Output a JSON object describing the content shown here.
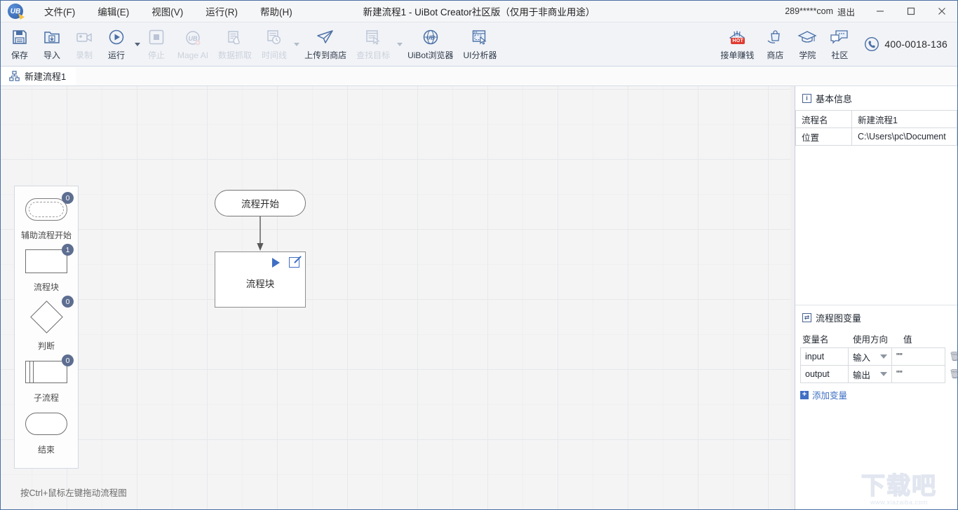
{
  "titlebar": {
    "logo_text": "UB",
    "menus": [
      {
        "label": "文件(F)",
        "name": "menu-file"
      },
      {
        "label": "编辑(E)",
        "name": "menu-edit"
      },
      {
        "label": "视图(V)",
        "name": "menu-view"
      },
      {
        "label": "运行(R)",
        "name": "menu-run"
      },
      {
        "label": "帮助(H)",
        "name": "menu-help"
      }
    ],
    "window_title": "新建流程1 - UiBot Creator社区版（仅用于非商业用途）",
    "account": "289*****com",
    "logout": "退出",
    "minimize": "—",
    "maximize": "☐",
    "close": "✕"
  },
  "toolbar": {
    "items": [
      {
        "label": "保存",
        "icon": "save-icon",
        "disabled": false,
        "caret": false
      },
      {
        "label": "导入",
        "icon": "import-icon",
        "disabled": false,
        "caret": false
      },
      {
        "label": "录制",
        "icon": "record-icon",
        "disabled": true,
        "caret": false
      },
      {
        "label": "运行",
        "icon": "run-icon",
        "disabled": false,
        "caret": true
      },
      {
        "label": "停止",
        "icon": "stop-icon",
        "disabled": true,
        "caret": false
      },
      {
        "label": "Mage AI",
        "icon": "mage-ai-icon",
        "disabled": true,
        "caret": false
      },
      {
        "label": "数据抓取",
        "icon": "data-scrape-icon",
        "disabled": true,
        "caret": false
      },
      {
        "label": "时间线",
        "icon": "timeline-icon",
        "disabled": true,
        "caret": true
      },
      {
        "label": "上传到商店",
        "icon": "upload-store-icon",
        "disabled": false,
        "caret": false
      },
      {
        "label": "查找目标",
        "icon": "find-target-icon",
        "disabled": true,
        "caret": true
      },
      {
        "label": "UiBot浏览器",
        "icon": "uibot-browser-icon",
        "disabled": false,
        "caret": false
      },
      {
        "label": "UI分析器",
        "icon": "ui-analyzer-icon",
        "disabled": false,
        "caret": false
      }
    ],
    "right_items": [
      {
        "label": "接单赚钱",
        "icon": "earn-money-icon",
        "badge": "HOT"
      },
      {
        "label": "商店",
        "icon": "store-icon",
        "badge": ""
      },
      {
        "label": "学院",
        "icon": "academy-icon",
        "badge": ""
      },
      {
        "label": "社区",
        "icon": "community-icon",
        "badge": ""
      }
    ],
    "phone": "400-0018-136"
  },
  "tabs": [
    {
      "label": "新建流程1",
      "icon": "flowchart-icon",
      "active": true
    }
  ],
  "palette": {
    "items": [
      {
        "label": "辅助流程开始",
        "count": "0",
        "shape": "terminal-dashed",
        "name": "palette-item-aux-start"
      },
      {
        "label": "流程块",
        "count": "1",
        "shape": "rect",
        "name": "palette-item-process-block"
      },
      {
        "label": "判断",
        "count": "0",
        "shape": "diamond",
        "name": "palette-item-decision"
      },
      {
        "label": "子流程",
        "count": "0",
        "shape": "subprocess",
        "name": "palette-item-subprocess"
      },
      {
        "label": "结束",
        "count": "",
        "shape": "terminal",
        "name": "palette-item-end"
      }
    ]
  },
  "canvas": {
    "start_node": "流程开始",
    "block_node": "流程块",
    "hint": "按Ctrl+鼠标左键拖动流程图"
  },
  "basic_info": {
    "title": "基本信息",
    "icon": "info-icon",
    "rows": [
      {
        "key": "流程名",
        "value": "新建流程1"
      },
      {
        "key": "位置",
        "value": "C:\\Users\\pc\\Document"
      }
    ]
  },
  "flow_variables": {
    "title": "流程图变量",
    "icon": "variable-icon",
    "headers": [
      "变量名",
      "使用方向",
      "值"
    ],
    "rows": [
      {
        "name": "input",
        "direction": "输入",
        "value": "\"\"",
        "delete_icon": "trash-icon"
      },
      {
        "name": "output",
        "direction": "输出",
        "value": "\"\"",
        "delete_icon": "trash-icon"
      }
    ],
    "add_label": "添加变量",
    "add_icon": "plus-icon"
  },
  "watermark": {
    "main": "下载吧",
    "sub": "www.xiazaiba.com"
  }
}
